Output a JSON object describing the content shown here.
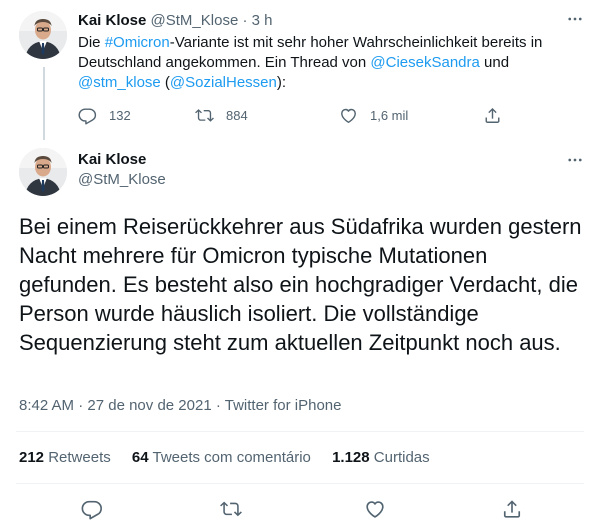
{
  "first_tweet": {
    "author_name": "Kai Klose",
    "handle": "@StM_Klose",
    "separator": "·",
    "time": "3 h",
    "text": {
      "p1": "Die ",
      "hashtag": "#Omicron",
      "p2": "-Variante ist mit sehr hoher Wahrscheinlichkeit bereits in Deutschland angekommen. Ein Thread von ",
      "mention1": "@CiesekSandra",
      "p3": " und ",
      "mention2": "@stm_klose",
      "p4": " (",
      "mention3": "@SozialHessen",
      "p5": "):"
    },
    "actions": {
      "replies": "132",
      "retweets": "884",
      "likes": "1,6 mil"
    },
    "icons": [
      "avatar",
      "more-icon",
      "reply-icon",
      "retweet-icon",
      "like-icon",
      "share-icon"
    ]
  },
  "main_tweet": {
    "author_name": "Kai Klose",
    "handle": "@StM_Klose",
    "text": "Bei einem Reiserückkehrer aus Südafrika wurden gestern Nacht mehrere für Omicron typische Mutationen gefunden. Es besteht also ein hochgradiger Verdacht, die Person wurde häuslich isoliert. Die vollständige Sequenzierung steht zum aktuellen Zeitpunkt noch aus.",
    "time": "8:42 AM",
    "sep": "·",
    "date": "27 de nov de 2021",
    "source": "Twitter for iPhone",
    "stats": {
      "retweets_count": "212",
      "retweets_label": "Retweets",
      "quotes_count": "64",
      "quotes_label": "Tweets com comentário",
      "likes_count": "1.128",
      "likes_label": "Curtidas"
    },
    "icons": [
      "avatar",
      "more-icon",
      "reply-icon",
      "retweet-icon",
      "like-icon",
      "share-icon"
    ]
  },
  "colors": {
    "text": "#0f1419",
    "muted": "#536471",
    "link": "#1d9bf0",
    "border": "#eff3f4",
    "thread_line": "#cfd9de"
  }
}
